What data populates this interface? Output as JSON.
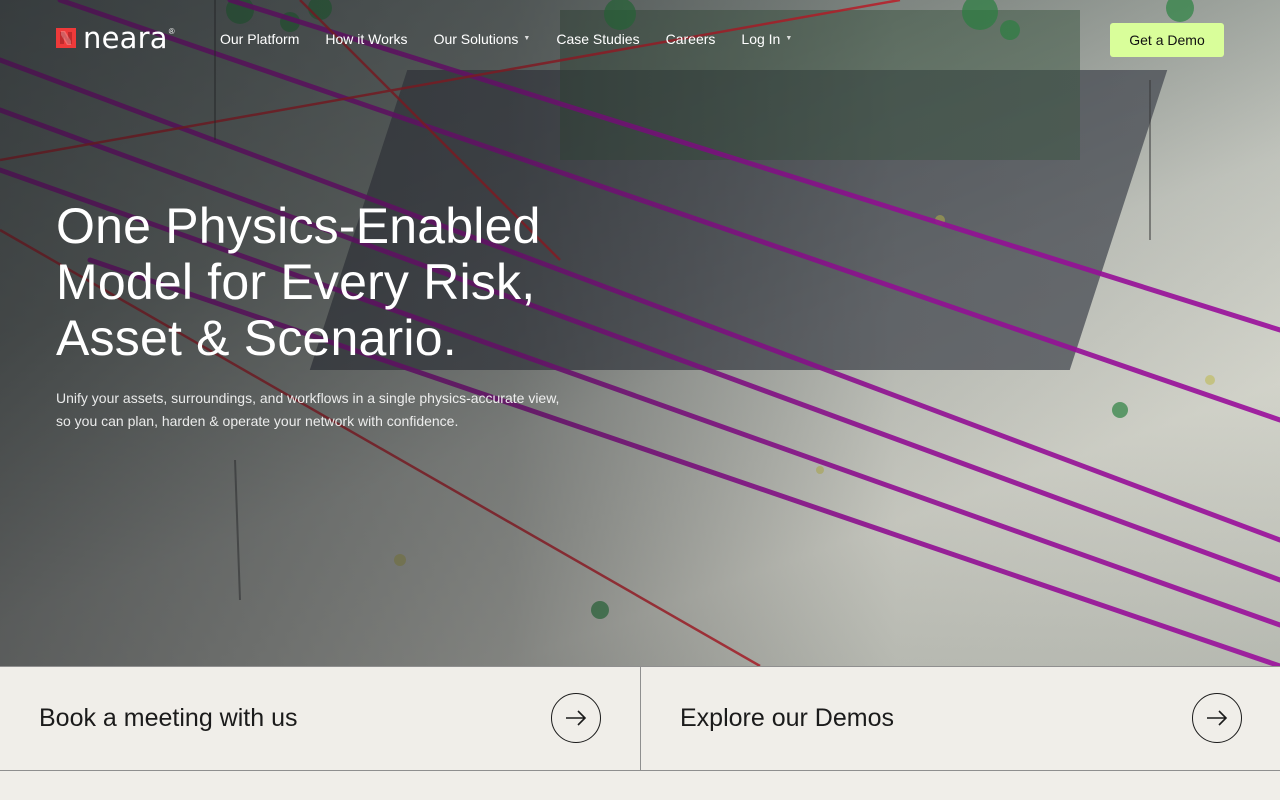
{
  "brand": {
    "name": "neara",
    "trademark": "®",
    "accent": "#ee3a3a"
  },
  "nav": {
    "items": [
      {
        "label": "Our Platform",
        "has_dropdown": false
      },
      {
        "label": "How it Works",
        "has_dropdown": false
      },
      {
        "label": "Our Solutions",
        "has_dropdown": true
      },
      {
        "label": "Case Studies",
        "has_dropdown": false
      },
      {
        "label": "Careers",
        "has_dropdown": false
      },
      {
        "label": "Log In",
        "has_dropdown": true
      }
    ],
    "caret": "▼",
    "cta_label": "Get a Demo",
    "cta_color": "#d9fe9a"
  },
  "hero": {
    "headline_lines": [
      "One Physics-Enabled",
      "Model for Every Risk,",
      "Asset & Scenario."
    ],
    "subtext_lines": [
      "Unify your assets, surroundings, and workflows in a single physics-accurate view,",
      "so you can plan, harden & operate your network with confidence."
    ]
  },
  "cards": [
    {
      "label": "Book a meeting with us",
      "icon": "arrow-right-icon"
    },
    {
      "label": "Explore our Demos",
      "icon": "arrow-right-icon"
    }
  ]
}
